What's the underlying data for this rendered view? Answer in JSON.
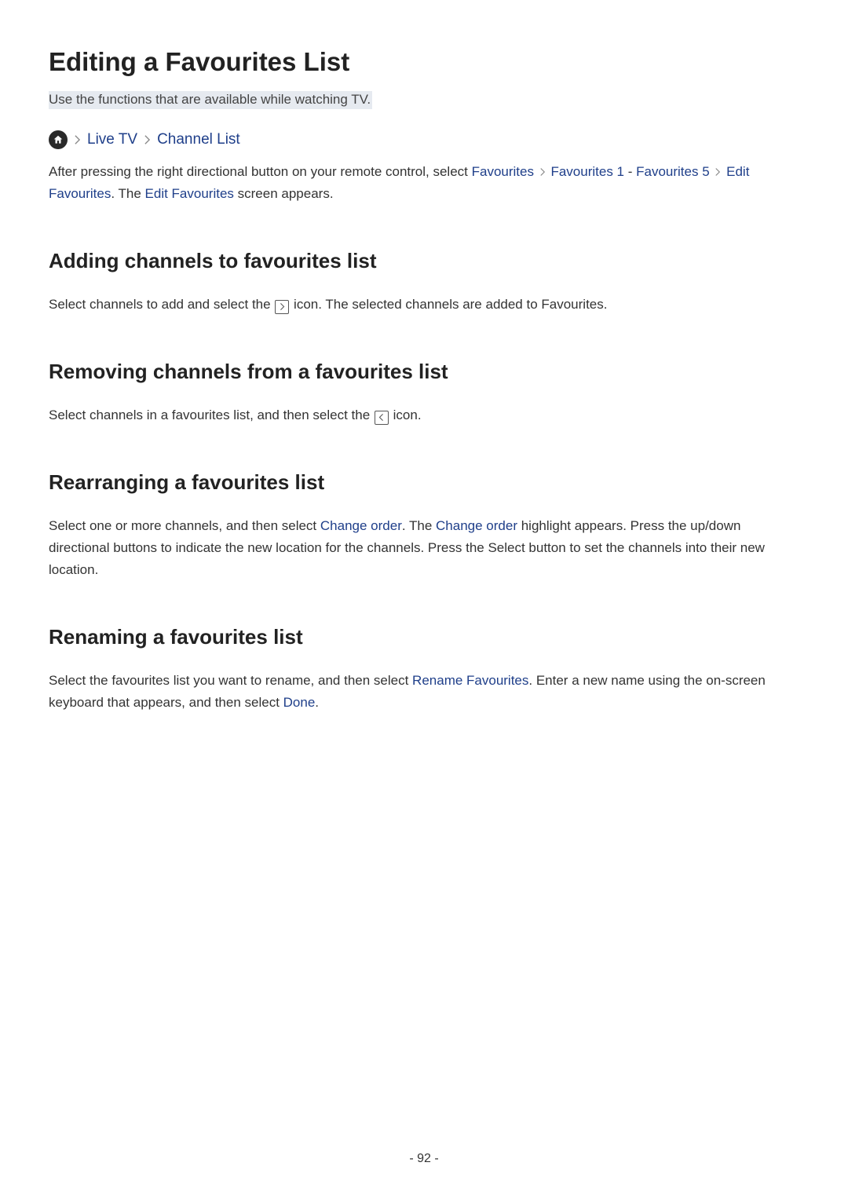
{
  "title": "Editing a Favourites List",
  "subtitle": "Use the functions that are available while watching TV.",
  "breadcrumb": {
    "live_tv": "Live TV",
    "channel_list": "Channel List"
  },
  "intro": {
    "pre": "After pressing the right directional button on your remote control, select ",
    "favourites": "Favourites",
    "fav1": "Favourites 1",
    "dash": " - ",
    "fav5": "Favourites 5",
    "edit_fav": "Edit Favourites",
    "the": ". The ",
    "edit_fav2": "Edit Favourites",
    "after": " screen appears."
  },
  "sections": {
    "adding": {
      "h": "Adding channels to favourites list",
      "p1": "Select channels to add and select the ",
      "p2": " icon. The selected channels are added to Favourites."
    },
    "removing": {
      "h": "Removing channels from a favourites list",
      "p1": "Select channels in a favourites list, and then select the ",
      "p2": " icon."
    },
    "rearranging": {
      "h": "Rearranging a favourites list",
      "p1": "Select one or more channels, and then select ",
      "change_order": "Change order",
      "p2": ". The ",
      "change_order2": "Change order",
      "p3": " highlight appears. Press the up/down directional buttons to indicate the new location for the channels. Press the Select button to set the channels into their new location."
    },
    "renaming": {
      "h": "Renaming a favourites list",
      "p1": "Select the favourites list you want to rename, and then select ",
      "rename_fav": "Rename Favourites",
      "p2": ". Enter a new name using the on-screen keyboard that appears, and then select ",
      "done": "Done",
      "p3": "."
    }
  },
  "page_number": "- 92 -"
}
